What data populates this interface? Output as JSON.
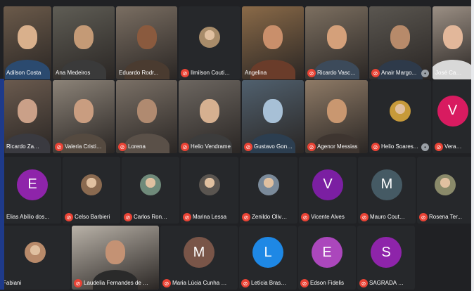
{
  "participants": [
    {
      "name": "Adilson Costa",
      "kind": "video",
      "muted": false,
      "bg": "#6b5a4a",
      "skin": "#d9b08c",
      "shirt": "#2b4a6f"
    },
    {
      "name": "Ana Medeiros",
      "kind": "video",
      "muted": false,
      "bg": "#5f5d55",
      "skin": "#c49a76",
      "shirt": "#3a3a3a"
    },
    {
      "name": "Eduardo Rodr...",
      "kind": "video",
      "muted": false,
      "bg": "#7a6e62",
      "skin": "#8a5a3e",
      "shirt": "#4a3b30"
    },
    {
      "name": "Ilmilson Coutinho",
      "kind": "photo",
      "muted": true,
      "photo": "#a88c6a"
    },
    {
      "name": "Angelina",
      "kind": "video",
      "muted": false,
      "bg": "#8a6a48",
      "skin": "#c98f6b",
      "shirt": "#6a3c2a"
    },
    {
      "name": "Ricardo Vasconcel...",
      "kind": "video",
      "muted": true,
      "bg": "#7c6f60",
      "skin": "#d4a07a",
      "shirt": "#3c4a5a"
    },
    {
      "name": "Anair Margo...",
      "kind": "video",
      "muted": true,
      "bg": "#5a5650",
      "skin": "#b78a6a",
      "shirt": "#2e3a4a",
      "pin": true
    },
    {
      "name": "José Carlos",
      "kind": "video",
      "muted": false,
      "bg": "#9b8f84",
      "skin": "#e2b79a",
      "shirt": "#d8d8d8"
    },
    {
      "name": "Ricardo Zanati",
      "kind": "video",
      "muted": false,
      "bg": "#6a5a4e",
      "skin": "#caa088",
      "shirt": "#3a3a40"
    },
    {
      "name": "Valeria Cristina Go...",
      "kind": "video",
      "muted": true,
      "bg": "#8c8378",
      "skin": "#c99d80",
      "shirt": "#554a40"
    },
    {
      "name": "Lorena",
      "kind": "video",
      "muted": true,
      "bg": "#7a7066",
      "skin": "#b08a70",
      "shirt": "#5a5048"
    },
    {
      "name": "Helio Vendrame",
      "kind": "video",
      "muted": true,
      "bg": "#6c6660",
      "skin": "#d6b090",
      "shirt": "#3c3c3c"
    },
    {
      "name": "Gustavo Gonçalv...",
      "kind": "video",
      "muted": true,
      "bg": "#50606e",
      "skin": "#a7c0d6",
      "shirt": "#2c3e50"
    },
    {
      "name": "Agenor Messias",
      "kind": "video",
      "muted": true,
      "bg": "#8e7a66",
      "skin": "#c99770",
      "shirt": "#3e3530"
    },
    {
      "name": "Helio Soares...",
      "kind": "photo",
      "muted": true,
      "photo": "#c79a3a",
      "pin": true
    },
    {
      "name": "Vera Lucia R",
      "kind": "letter",
      "muted": true,
      "letter": "V",
      "color": "#d81b60"
    },
    {
      "name": "Elias Abílio dos...",
      "kind": "letter",
      "muted": false,
      "letter": "E",
      "color": "#8e24aa"
    },
    {
      "name": "Celso Barbieri",
      "kind": "photo",
      "muted": true,
      "photo": "#8a6a50"
    },
    {
      "name": "Carlos Ronald Wa...",
      "kind": "photo",
      "muted": true,
      "photo": "#6f8a7a"
    },
    {
      "name": "Marina Lessa",
      "kind": "photo",
      "muted": true,
      "photo": "#5a5550"
    },
    {
      "name": "Zenildo Oliveira",
      "kind": "photo",
      "muted": true,
      "photo": "#7a8a9a"
    },
    {
      "name": "Vicente Alves",
      "kind": "letter",
      "muted": true,
      "letter": "V",
      "color": "#7b1fa2"
    },
    {
      "name": "Mauro Coutinho...",
      "kind": "letter",
      "muted": true,
      "letter": "M",
      "color": "#455a64"
    },
    {
      "name": "Rosena Ter...",
      "kind": "photo",
      "muted": true,
      "photo": "#8a8a6a"
    },
    {
      "name": "Fabiani",
      "kind": "photo",
      "muted": false,
      "photo": "#b88a6a"
    },
    {
      "name": "Laudelia Fernandes de Oliveira",
      "kind": "video",
      "muted": true,
      "bg": "#b9b2a8",
      "skin": "#c49274",
      "shirt": "#2a2a2a"
    },
    {
      "name": "Maria Lúcia Cunha Sorsoli...",
      "kind": "letter",
      "muted": true,
      "letter": "M",
      "color": "#795548"
    },
    {
      "name": "Letícia Brasília",
      "kind": "letter",
      "muted": true,
      "letter": "L",
      "color": "#1e88e5"
    },
    {
      "name": "Edson Fidelis",
      "kind": "letter",
      "muted": true,
      "letter": "E",
      "color": "#ab47bc"
    },
    {
      "name": "SAGRADA SERVIÇOS",
      "kind": "letter",
      "muted": true,
      "letter": "S",
      "color": "#8e24aa"
    }
  ]
}
